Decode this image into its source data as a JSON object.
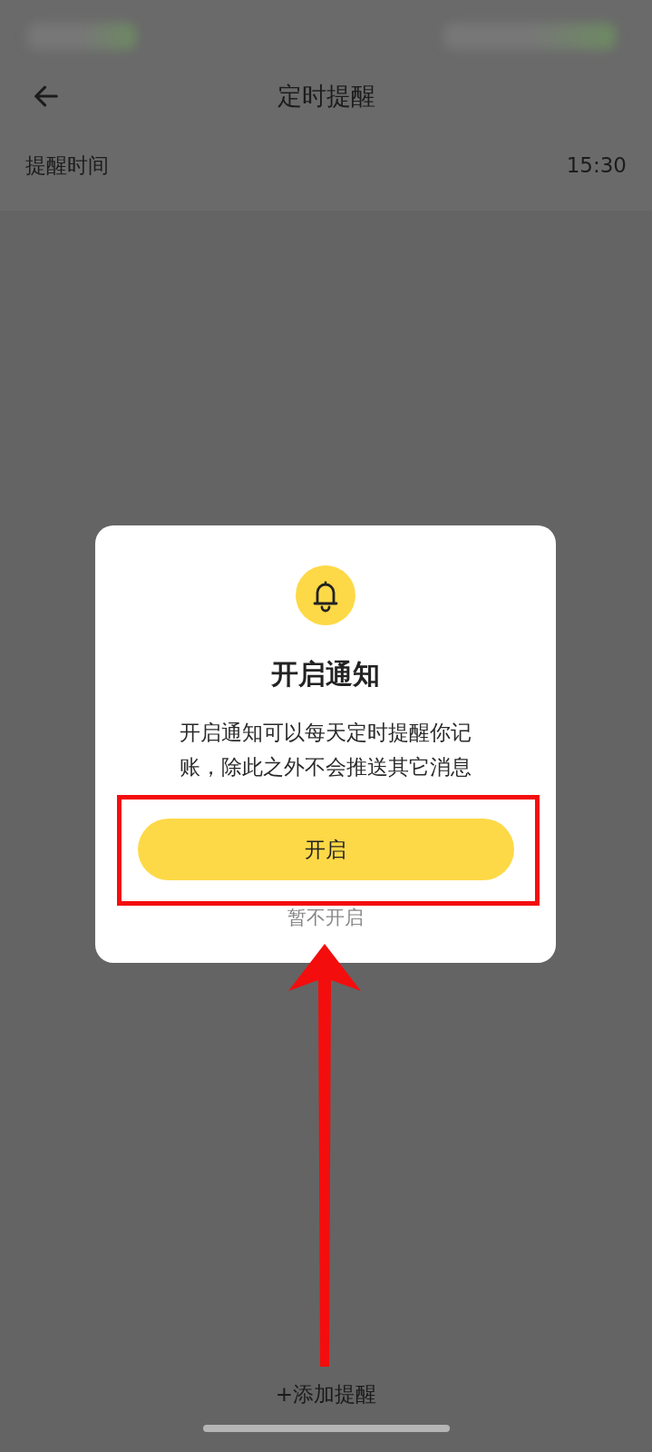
{
  "header": {
    "title": "定时提醒"
  },
  "reminder": {
    "label": "提醒时间",
    "time": "15:30"
  },
  "dialog": {
    "title": "开启通知",
    "message": "开启通知可以每天定时提醒你记账，除此之外不会推送其它消息",
    "confirm": "开启",
    "cancel": "暂不开启"
  },
  "add_button": "+添加提醒"
}
